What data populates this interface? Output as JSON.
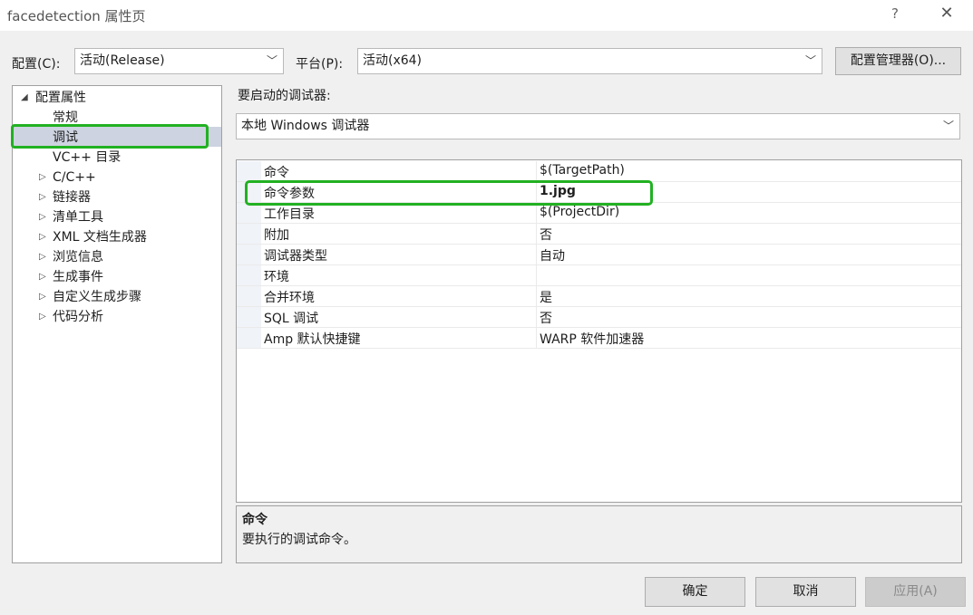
{
  "window": {
    "title": "facedetection 属性页",
    "help": "?",
    "close": "✕"
  },
  "toolbar": {
    "config_label": "配置(C):",
    "config_value": "活动(Release)",
    "platform_label": "平台(P):",
    "platform_value": "活动(x64)",
    "config_manager": "配置管理器(O)..."
  },
  "tree": {
    "root": "配置属性",
    "items": [
      {
        "label": "常规"
      },
      {
        "label": "调试",
        "selected": true
      },
      {
        "label": "VC++ 目录"
      },
      {
        "label": "C/C++"
      },
      {
        "label": "链接器"
      },
      {
        "label": "清单工具"
      },
      {
        "label": "XML 文档生成器"
      },
      {
        "label": "浏览信息"
      },
      {
        "label": "生成事件"
      },
      {
        "label": "自定义生成步骤"
      },
      {
        "label": "代码分析"
      }
    ]
  },
  "debugger": {
    "label": "要启动的调试器:",
    "value": "本地 Windows 调试器"
  },
  "properties": [
    {
      "name": "命令",
      "value": "$(TargetPath)"
    },
    {
      "name": "命令参数",
      "value": "1.jpg",
      "bold": true
    },
    {
      "name": "工作目录",
      "value": "$(ProjectDir)"
    },
    {
      "name": "附加",
      "value": "否"
    },
    {
      "name": "调试器类型",
      "value": "自动"
    },
    {
      "name": "环境",
      "value": ""
    },
    {
      "name": "合并环境",
      "value": "是"
    },
    {
      "name": "SQL 调试",
      "value": "否"
    },
    {
      "name": "Amp 默认快捷键",
      "value": "WARP 软件加速器"
    }
  ],
  "description": {
    "title": "命令",
    "text": "要执行的调试命令。"
  },
  "buttons": {
    "ok": "确定",
    "cancel": "取消",
    "apply": "应用(A)"
  },
  "colors": {
    "highlight": "#22b122",
    "selection": "#cdd3e0"
  }
}
